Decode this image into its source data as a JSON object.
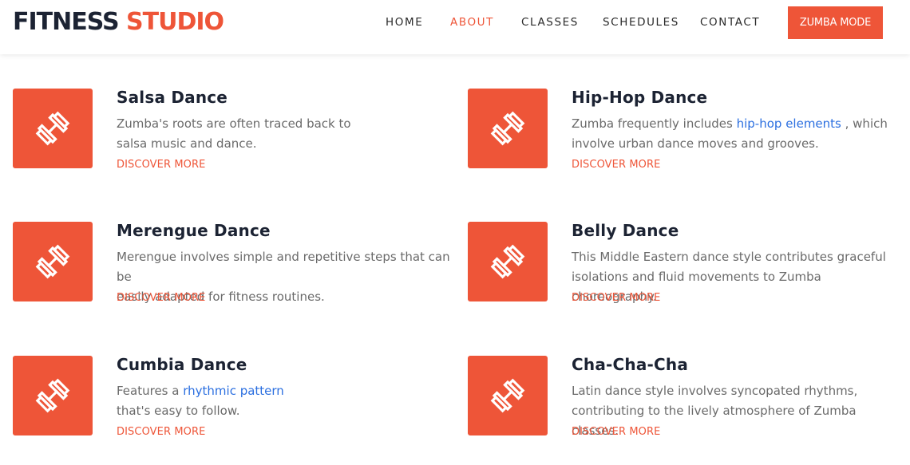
{
  "brand": {
    "part1": "FITNESS",
    "part2": "STUDIO"
  },
  "nav": {
    "items": [
      {
        "label": "HOME"
      },
      {
        "label": "ABOUT"
      },
      {
        "label": "CLASSES"
      },
      {
        "label": "SCHEDULES"
      },
      {
        "label": "CONTACT"
      }
    ],
    "active": "ABOUT",
    "cta_label": "ZUMBA MODE"
  },
  "colors": {
    "accent": "#ee5538",
    "link": "#2b6fe0",
    "heading": "#1c2333"
  },
  "card_icon": "dumbbell-icon",
  "discover_label": "DISCOVER MORE",
  "cards": [
    {
      "title": "Salsa Dance",
      "line1": "Zumba's roots are often traced back to",
      "line2": "salsa music and dance."
    },
    {
      "title": "Hip-Hop Dance",
      "before": "Zumba frequently includes ",
      "link": "hip-hop elements",
      "after": " , which",
      "line2": "involve urban dance moves and grooves."
    },
    {
      "title": "Merengue Dance",
      "line1": "Merengue involves simple and repetitive steps that can be",
      "line2": "easily adapted for fitness routines."
    },
    {
      "title": "Belly Dance",
      "line1": "This Middle Eastern dance style contributes graceful",
      "line2": "isolations and fluid movements to Zumba choreography."
    },
    {
      "title": "Cumbia Dance",
      "before": "Features a ",
      "link": "rhythmic pattern",
      "after": "",
      "line2": "that's easy to follow."
    },
    {
      "title": "Cha-Cha-Cha",
      "line1": "Latin dance style involves syncopated rhythms,",
      "line2": "contributing to the lively atmosphere of Zumba classes."
    }
  ]
}
